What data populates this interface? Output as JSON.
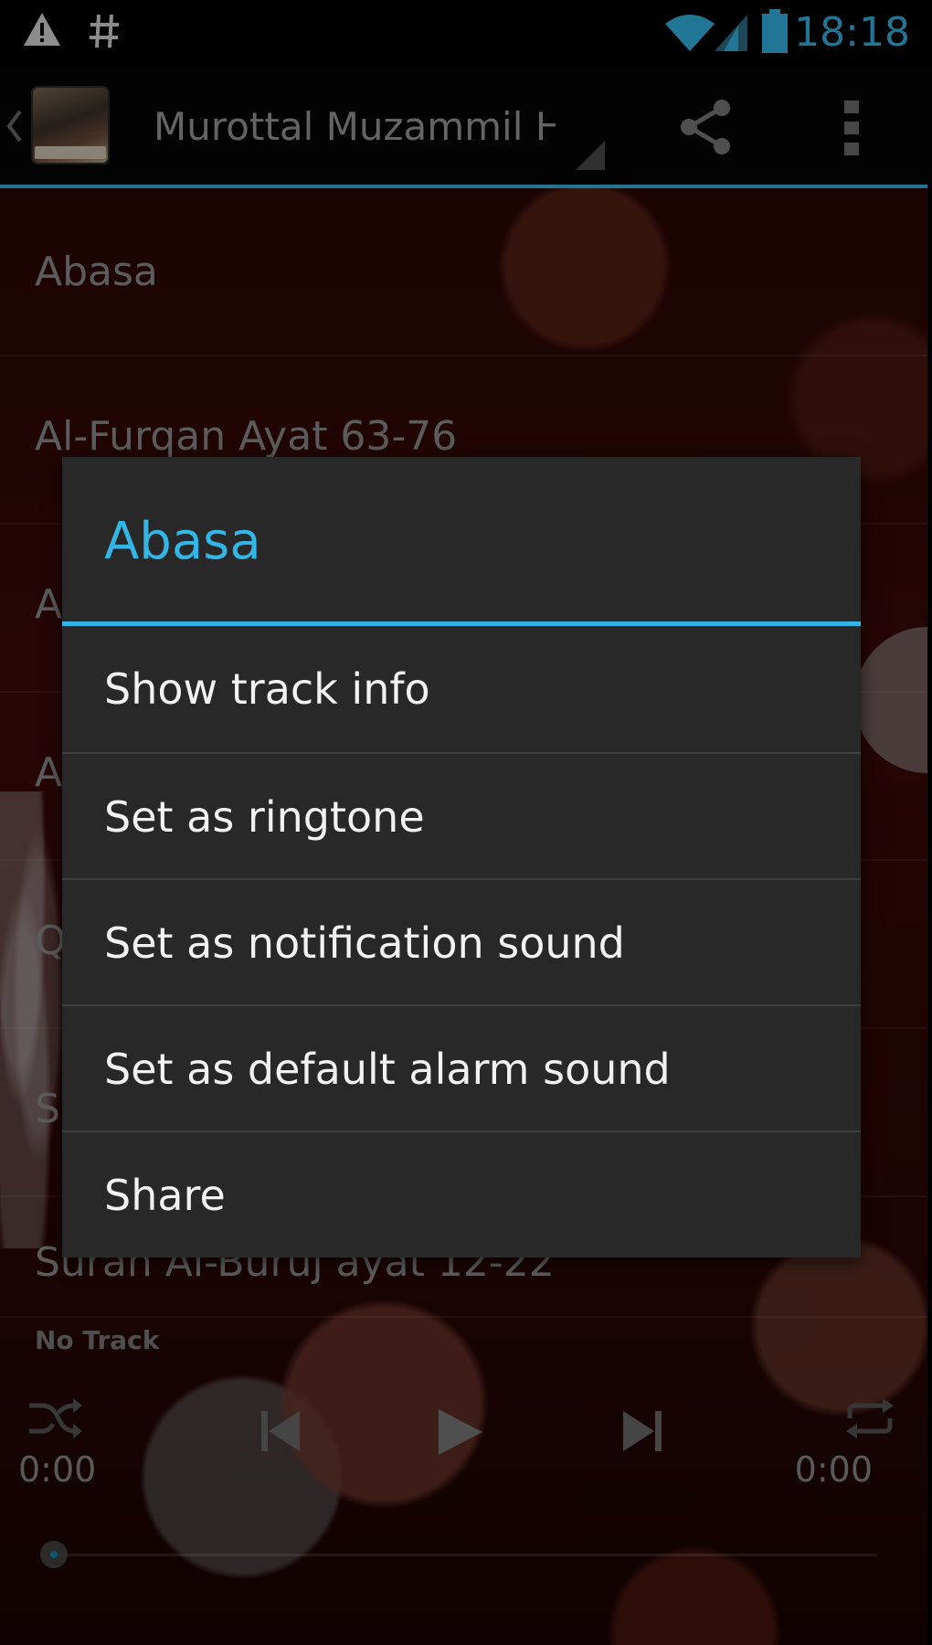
{
  "status_bar": {
    "left_icons": [
      "warning-icon",
      "hash-icon"
    ],
    "right_icons": [
      "wifi-icon",
      "signal-icon",
      "battery-icon"
    ],
    "time": "18:18"
  },
  "action_bar": {
    "title": "Murottal Muzammil H",
    "icons": [
      "back-icon",
      "share-icon",
      "overflow-menu-icon"
    ]
  },
  "track_list": {
    "items": [
      "Abasa",
      "Al-Furqan Ayat 63-76",
      "A",
      "A",
      "Q",
      "S",
      "Surah Al-Buruj ayat 12-22"
    ]
  },
  "player": {
    "now_playing": "No Track",
    "time_elapsed": "0:00",
    "time_total": "0:00",
    "icons": [
      "shuffle-icon",
      "previous-icon",
      "play-icon",
      "next-icon",
      "repeat-icon"
    ]
  },
  "dialog": {
    "title": "Abasa",
    "items": [
      "Show track info",
      "Set as ringtone",
      "Set as notification sound",
      "Set as default alarm sound",
      "Share"
    ]
  },
  "colors": {
    "accent": "#33b5e5",
    "dialog_bg": "#282828",
    "background": "#3b0a08"
  }
}
